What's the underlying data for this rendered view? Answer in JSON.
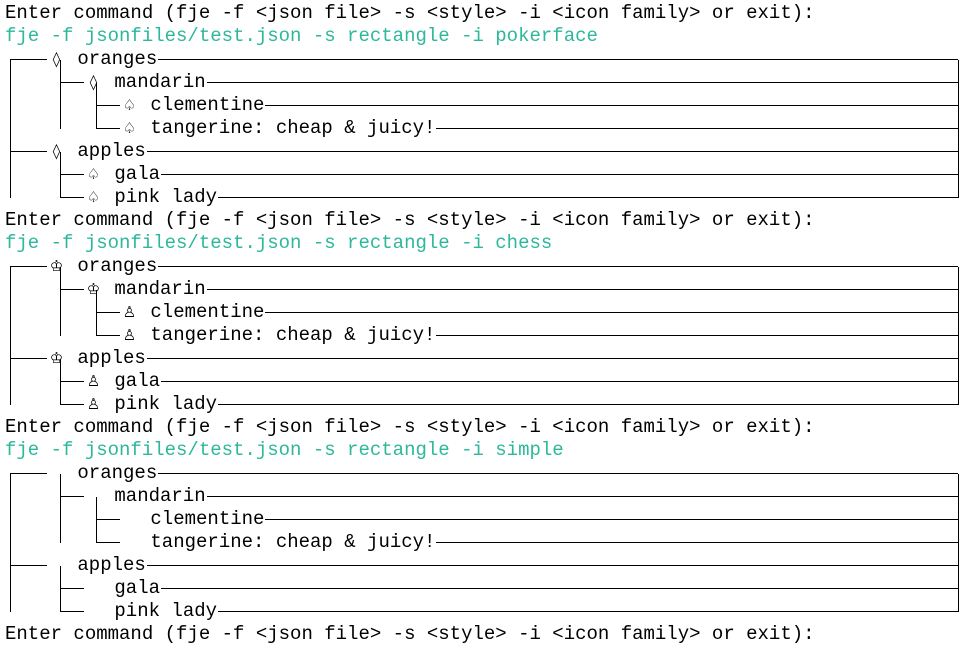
{
  "prompt": "Enter command (fje -f <json file> -s <style> -i <icon family> or exit):",
  "runs": [
    {
      "command": "fje -f jsonfiles/test.json -s rectangle -i pokerface",
      "icon_family": "pokerface",
      "icons": {
        "container": "◊",
        "leaf": "♤"
      },
      "nodes": [
        {
          "label": "oranges"
        },
        {
          "label": "mandarin"
        },
        {
          "label": "clementine"
        },
        {
          "label": "tangerine: cheap & juicy!"
        },
        {
          "label": "apples"
        },
        {
          "label": "gala"
        },
        {
          "label": "pink lady"
        }
      ]
    },
    {
      "command": "fje -f jsonfiles/test.json -s rectangle -i chess",
      "icon_family": "chess",
      "icons": {
        "container": "♔",
        "leaf": "♙"
      },
      "nodes": [
        {
          "label": "oranges"
        },
        {
          "label": "mandarin"
        },
        {
          "label": "clementine"
        },
        {
          "label": "tangerine: cheap & juicy!"
        },
        {
          "label": "apples"
        },
        {
          "label": "gala"
        },
        {
          "label": "pink lady"
        }
      ]
    },
    {
      "command": "fje -f jsonfiles/test.json -s rectangle -i simple",
      "icon_family": "simple",
      "icons": {
        "container": " ",
        "leaf": " "
      },
      "nodes": [
        {
          "label": "oranges"
        },
        {
          "label": "mandarin"
        },
        {
          "label": "clementine"
        },
        {
          "label": "tangerine: cheap & juicy!"
        },
        {
          "label": "apples"
        },
        {
          "label": "gala"
        },
        {
          "label": "pink lady"
        }
      ]
    }
  ],
  "colors": {
    "command": "#2db89b",
    "text": "#000000",
    "background": "#ffffff"
  }
}
